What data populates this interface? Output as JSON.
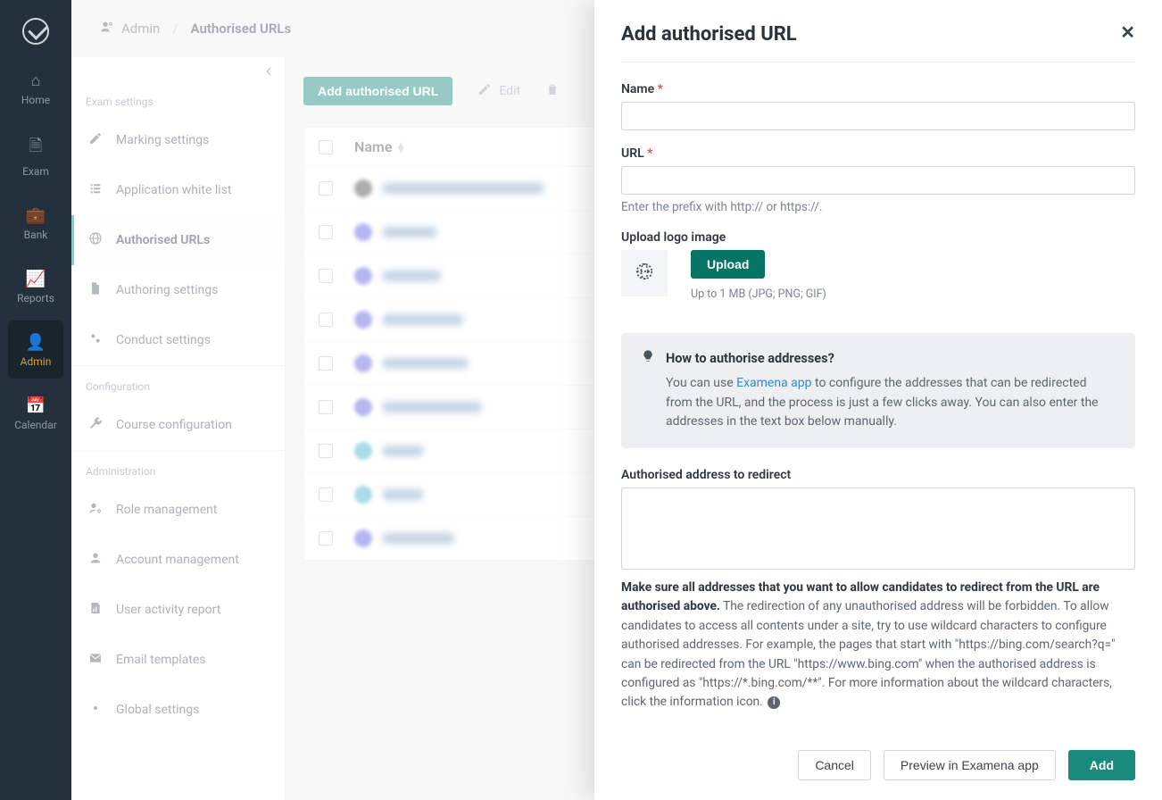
{
  "colors": {
    "brand_teal": "#198b7d",
    "accent_gold": "#d1a04a"
  },
  "iconnav": {
    "items": [
      {
        "id": "home",
        "label": "Home",
        "glyph": "⌂"
      },
      {
        "id": "exam",
        "label": "Exam",
        "glyph": "🗎"
      },
      {
        "id": "bank",
        "label": "Bank",
        "glyph": "💼"
      },
      {
        "id": "reports",
        "label": "Reports",
        "glyph": "📈"
      },
      {
        "id": "admin",
        "label": "Admin",
        "glyph": "👤"
      },
      {
        "id": "calendar",
        "label": "Calendar",
        "glyph": "📅"
      }
    ],
    "active_id": "admin"
  },
  "breadcrumb": {
    "root": "Admin",
    "current": "Authorised URLs"
  },
  "sidebar": {
    "sections": [
      {
        "heading": "Exam settings",
        "items": [
          {
            "label": "Marking settings",
            "icon": "pencil-icon"
          },
          {
            "label": "Application white list",
            "icon": "list-icon"
          },
          {
            "label": "Authorised URLs",
            "icon": "globe-icon",
            "active": true
          },
          {
            "label": "Authoring settings",
            "icon": "doc-icon"
          },
          {
            "label": "Conduct settings",
            "icon": "gears-icon"
          }
        ]
      },
      {
        "heading": "Configuration",
        "items": [
          {
            "label": "Course configuration",
            "icon": "wrench-icon"
          }
        ]
      },
      {
        "heading": "Administration",
        "items": [
          {
            "label": "Role management",
            "icon": "user-gear-icon"
          },
          {
            "label": "Account management",
            "icon": "user-icon"
          },
          {
            "label": "User activity report",
            "icon": "report-icon"
          },
          {
            "label": "Email templates",
            "icon": "mail-icon"
          },
          {
            "label": "Global settings",
            "icon": "gear-icon"
          }
        ]
      }
    ]
  },
  "toolbar": {
    "add_label": "Add authorised URL",
    "edit_label": "Edit",
    "delete_label": ""
  },
  "table": {
    "column_name": "Name",
    "rows_count": 9
  },
  "drawer": {
    "title": "Add authorised URL",
    "name_label": "Name",
    "url_label": "URL",
    "url_hint": "Enter the prefix with http:// or https://.",
    "upload_heading": "Upload logo image",
    "upload_button": "Upload",
    "upload_hint": "Up to 1 MB (JPG; PNG; GIF)",
    "info_title": "How to authorise addresses?",
    "info_body_pre": "You can use ",
    "info_body_link": "Examena app",
    "info_body_post": " to configure the addresses that can be redirected from the URL, and the process is just a few clicks away. You can also enter the addresses in the text box below manually.",
    "auth_address_label": "Authorised address to redirect",
    "help_bold": "Make sure all addresses that you want to allow candidates to redirect from the URL are authorised above.",
    "help_rest": " The redirection of any unauthorised address will be forbidden. To allow candidates to access all contents under a site, try to use wildcard characters to configure authorised addresses. For example, the pages that start with \"https://bing.com/search?q=\" can be redirected from the URL \"https://www.bing.com\" when the authorised address is configured as \"https://*.bing.com/**\". For more information about the wildcard characters, click the information icon.",
    "footer": {
      "cancel": "Cancel",
      "preview": "Preview in Examena app",
      "add": "Add"
    }
  }
}
